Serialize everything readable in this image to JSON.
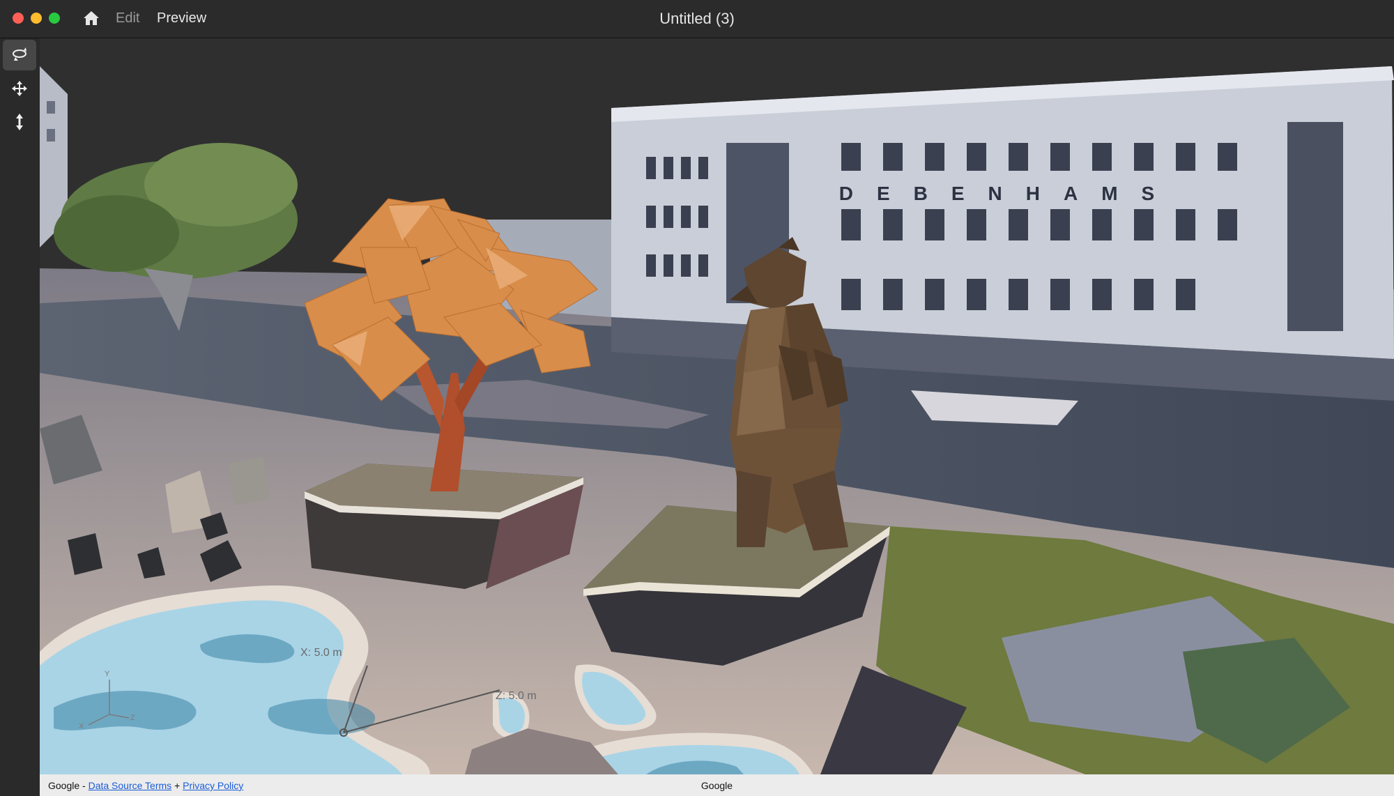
{
  "window": {
    "title": "Untitled (3)",
    "menu": {
      "edit": "Edit",
      "preview": "Preview"
    }
  },
  "toolbar": {
    "tools": [
      {
        "icon": "orbit-icon",
        "active": true
      },
      {
        "icon": "move-icon",
        "active": false
      },
      {
        "icon": "vertical-move-icon",
        "active": false
      }
    ]
  },
  "scene": {
    "sign_text": "DEBENHAMS",
    "axis_x_label": "X:  5.0 m",
    "axis_z_label": "Z:  5.0 m",
    "gizmo": {
      "y": "Y",
      "x": "X",
      "z": "Z"
    }
  },
  "footer": {
    "prefix": "Google -",
    "data_source_terms": "Data Source Terms",
    "plus": "+",
    "privacy_policy": "Privacy Policy",
    "center": "Google"
  },
  "colors": {
    "titlebar": "#2b2b2b",
    "toolbar": "#2a2a2a",
    "tree_foliage": "#d98d4a",
    "bear": "#6e5238",
    "water": "#a9d4e6",
    "link": "#1a5bd8"
  }
}
